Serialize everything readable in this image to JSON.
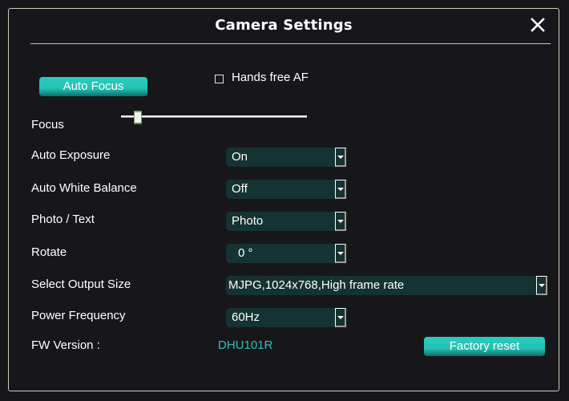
{
  "dialog": {
    "title": "Camera Settings",
    "close_icon": "close-icon"
  },
  "auto_focus": {
    "button_label": "Auto Focus",
    "hands_free_label": "Hands free AF",
    "hands_free_checked": false
  },
  "focus": {
    "label": "Focus",
    "value_fraction": 0.07
  },
  "settings": {
    "auto_exposure": {
      "label": "Auto Exposure",
      "value": "On"
    },
    "auto_white_balance": {
      "label": "Auto White Balance",
      "value": "Off"
    },
    "photo_text": {
      "label": "Photo / Text",
      "value": "Photo"
    },
    "rotate": {
      "label": "Rotate",
      "value": "0 °"
    },
    "output_size": {
      "label": "Select Output Size",
      "value": "MJPG,1024x768,High frame rate"
    },
    "power_frequency": {
      "label": "Power Frequency",
      "value": "60Hz"
    }
  },
  "firmware": {
    "label": "FW Version :",
    "value": "DHU101R"
  },
  "factory_reset": {
    "button_label": "Factory reset"
  },
  "colors": {
    "accent": "#2ec4b6",
    "background": "#17171b",
    "select_bg": "#153234",
    "border": "#cfcbb8"
  }
}
